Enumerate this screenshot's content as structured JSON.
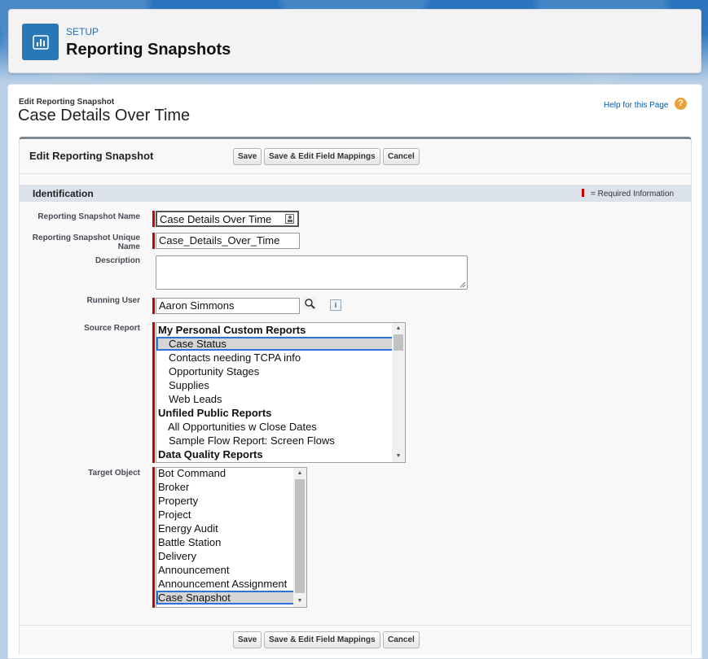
{
  "header": {
    "setup_label": "SETUP",
    "title": "Reporting Snapshots"
  },
  "page": {
    "subtitle": "Edit Reporting Snapshot",
    "title": "Case Details Over Time",
    "help_link": "Help for this Page"
  },
  "block": {
    "title": "Edit Reporting Snapshot",
    "buttons": {
      "save": "Save",
      "save_edit": "Save & Edit Field Mappings",
      "cancel": "Cancel"
    }
  },
  "section": {
    "title": "Identification",
    "required_note": "= Required Information"
  },
  "fields": {
    "name": {
      "label": "Reporting Snapshot Name",
      "value": "Case Details Over Time"
    },
    "unique_name": {
      "label": "Reporting Snapshot Unique Name",
      "value": "Case_Details_Over_Time"
    },
    "description": {
      "label": "Description",
      "value": ""
    },
    "running_user": {
      "label": "Running User",
      "value": "Aaron Simmons"
    },
    "source_report": {
      "label": "Source Report",
      "options": [
        {
          "text": "My Personal Custom Reports",
          "group": true
        },
        {
          "text": "Case Status",
          "selected": true
        },
        {
          "text": "Contacts needing TCPA info"
        },
        {
          "text": "Opportunity Stages"
        },
        {
          "text": "Supplies"
        },
        {
          "text": "Web Leads"
        },
        {
          "text": "Unfiled Public Reports",
          "group": true
        },
        {
          "text": "All Opportunities w Close Dates"
        },
        {
          "text": "Sample Flow Report: Screen Flows"
        },
        {
          "text": "Data Quality Reports",
          "group": true
        }
      ]
    },
    "target_object": {
      "label": "Target Object",
      "options": [
        {
          "text": "Bot Command"
        },
        {
          "text": "Broker"
        },
        {
          "text": "Property"
        },
        {
          "text": "Project"
        },
        {
          "text": "Energy Audit"
        },
        {
          "text": "Battle Station"
        },
        {
          "text": "Delivery"
        },
        {
          "text": "Announcement"
        },
        {
          "text": "Announcement Assignment"
        },
        {
          "text": "Case Snapshot",
          "selected": true
        }
      ]
    }
  },
  "colors": {
    "required": "#cc0000",
    "selection_outline": "#2d72d9",
    "header_icon": "#2878b8"
  }
}
